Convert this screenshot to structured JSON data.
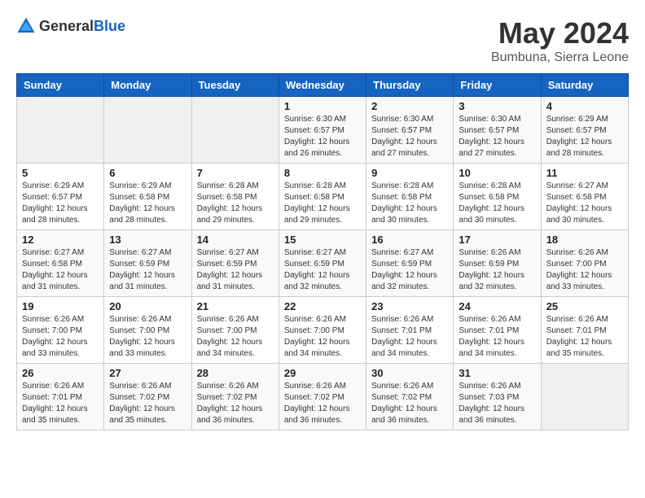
{
  "header": {
    "logo_general": "General",
    "logo_blue": "Blue",
    "title": "May 2024",
    "subtitle": "Bumbuna, Sierra Leone"
  },
  "calendar": {
    "weekdays": [
      "Sunday",
      "Monday",
      "Tuesday",
      "Wednesday",
      "Thursday",
      "Friday",
      "Saturday"
    ],
    "weeks": [
      [
        {
          "day": "",
          "sunrise": "",
          "sunset": "",
          "daylight": ""
        },
        {
          "day": "",
          "sunrise": "",
          "sunset": "",
          "daylight": ""
        },
        {
          "day": "",
          "sunrise": "",
          "sunset": "",
          "daylight": ""
        },
        {
          "day": "1",
          "sunrise": "Sunrise: 6:30 AM",
          "sunset": "Sunset: 6:57 PM",
          "daylight": "Daylight: 12 hours and 26 minutes."
        },
        {
          "day": "2",
          "sunrise": "Sunrise: 6:30 AM",
          "sunset": "Sunset: 6:57 PM",
          "daylight": "Daylight: 12 hours and 27 minutes."
        },
        {
          "day": "3",
          "sunrise": "Sunrise: 6:30 AM",
          "sunset": "Sunset: 6:57 PM",
          "daylight": "Daylight: 12 hours and 27 minutes."
        },
        {
          "day": "4",
          "sunrise": "Sunrise: 6:29 AM",
          "sunset": "Sunset: 6:57 PM",
          "daylight": "Daylight: 12 hours and 28 minutes."
        }
      ],
      [
        {
          "day": "5",
          "sunrise": "Sunrise: 6:29 AM",
          "sunset": "Sunset: 6:57 PM",
          "daylight": "Daylight: 12 hours and 28 minutes."
        },
        {
          "day": "6",
          "sunrise": "Sunrise: 6:29 AM",
          "sunset": "Sunset: 6:58 PM",
          "daylight": "Daylight: 12 hours and 28 minutes."
        },
        {
          "day": "7",
          "sunrise": "Sunrise: 6:28 AM",
          "sunset": "Sunset: 6:58 PM",
          "daylight": "Daylight: 12 hours and 29 minutes."
        },
        {
          "day": "8",
          "sunrise": "Sunrise: 6:28 AM",
          "sunset": "Sunset: 6:58 PM",
          "daylight": "Daylight: 12 hours and 29 minutes."
        },
        {
          "day": "9",
          "sunrise": "Sunrise: 6:28 AM",
          "sunset": "Sunset: 6:58 PM",
          "daylight": "Daylight: 12 hours and 30 minutes."
        },
        {
          "day": "10",
          "sunrise": "Sunrise: 6:28 AM",
          "sunset": "Sunset: 6:58 PM",
          "daylight": "Daylight: 12 hours and 30 minutes."
        },
        {
          "day": "11",
          "sunrise": "Sunrise: 6:27 AM",
          "sunset": "Sunset: 6:58 PM",
          "daylight": "Daylight: 12 hours and 30 minutes."
        }
      ],
      [
        {
          "day": "12",
          "sunrise": "Sunrise: 6:27 AM",
          "sunset": "Sunset: 6:58 PM",
          "daylight": "Daylight: 12 hours and 31 minutes."
        },
        {
          "day": "13",
          "sunrise": "Sunrise: 6:27 AM",
          "sunset": "Sunset: 6:59 PM",
          "daylight": "Daylight: 12 hours and 31 minutes."
        },
        {
          "day": "14",
          "sunrise": "Sunrise: 6:27 AM",
          "sunset": "Sunset: 6:59 PM",
          "daylight": "Daylight: 12 hours and 31 minutes."
        },
        {
          "day": "15",
          "sunrise": "Sunrise: 6:27 AM",
          "sunset": "Sunset: 6:59 PM",
          "daylight": "Daylight: 12 hours and 32 minutes."
        },
        {
          "day": "16",
          "sunrise": "Sunrise: 6:27 AM",
          "sunset": "Sunset: 6:59 PM",
          "daylight": "Daylight: 12 hours and 32 minutes."
        },
        {
          "day": "17",
          "sunrise": "Sunrise: 6:26 AM",
          "sunset": "Sunset: 6:59 PM",
          "daylight": "Daylight: 12 hours and 32 minutes."
        },
        {
          "day": "18",
          "sunrise": "Sunrise: 6:26 AM",
          "sunset": "Sunset: 7:00 PM",
          "daylight": "Daylight: 12 hours and 33 minutes."
        }
      ],
      [
        {
          "day": "19",
          "sunrise": "Sunrise: 6:26 AM",
          "sunset": "Sunset: 7:00 PM",
          "daylight": "Daylight: 12 hours and 33 minutes."
        },
        {
          "day": "20",
          "sunrise": "Sunrise: 6:26 AM",
          "sunset": "Sunset: 7:00 PM",
          "daylight": "Daylight: 12 hours and 33 minutes."
        },
        {
          "day": "21",
          "sunrise": "Sunrise: 6:26 AM",
          "sunset": "Sunset: 7:00 PM",
          "daylight": "Daylight: 12 hours and 34 minutes."
        },
        {
          "day": "22",
          "sunrise": "Sunrise: 6:26 AM",
          "sunset": "Sunset: 7:00 PM",
          "daylight": "Daylight: 12 hours and 34 minutes."
        },
        {
          "day": "23",
          "sunrise": "Sunrise: 6:26 AM",
          "sunset": "Sunset: 7:01 PM",
          "daylight": "Daylight: 12 hours and 34 minutes."
        },
        {
          "day": "24",
          "sunrise": "Sunrise: 6:26 AM",
          "sunset": "Sunset: 7:01 PM",
          "daylight": "Daylight: 12 hours and 34 minutes."
        },
        {
          "day": "25",
          "sunrise": "Sunrise: 6:26 AM",
          "sunset": "Sunset: 7:01 PM",
          "daylight": "Daylight: 12 hours and 35 minutes."
        }
      ],
      [
        {
          "day": "26",
          "sunrise": "Sunrise: 6:26 AM",
          "sunset": "Sunset: 7:01 PM",
          "daylight": "Daylight: 12 hours and 35 minutes."
        },
        {
          "day": "27",
          "sunrise": "Sunrise: 6:26 AM",
          "sunset": "Sunset: 7:02 PM",
          "daylight": "Daylight: 12 hours and 35 minutes."
        },
        {
          "day": "28",
          "sunrise": "Sunrise: 6:26 AM",
          "sunset": "Sunset: 7:02 PM",
          "daylight": "Daylight: 12 hours and 36 minutes."
        },
        {
          "day": "29",
          "sunrise": "Sunrise: 6:26 AM",
          "sunset": "Sunset: 7:02 PM",
          "daylight": "Daylight: 12 hours and 36 minutes."
        },
        {
          "day": "30",
          "sunrise": "Sunrise: 6:26 AM",
          "sunset": "Sunset: 7:02 PM",
          "daylight": "Daylight: 12 hours and 36 minutes."
        },
        {
          "day": "31",
          "sunrise": "Sunrise: 6:26 AM",
          "sunset": "Sunset: 7:03 PM",
          "daylight": "Daylight: 12 hours and 36 minutes."
        },
        {
          "day": "",
          "sunrise": "",
          "sunset": "",
          "daylight": ""
        }
      ]
    ]
  }
}
